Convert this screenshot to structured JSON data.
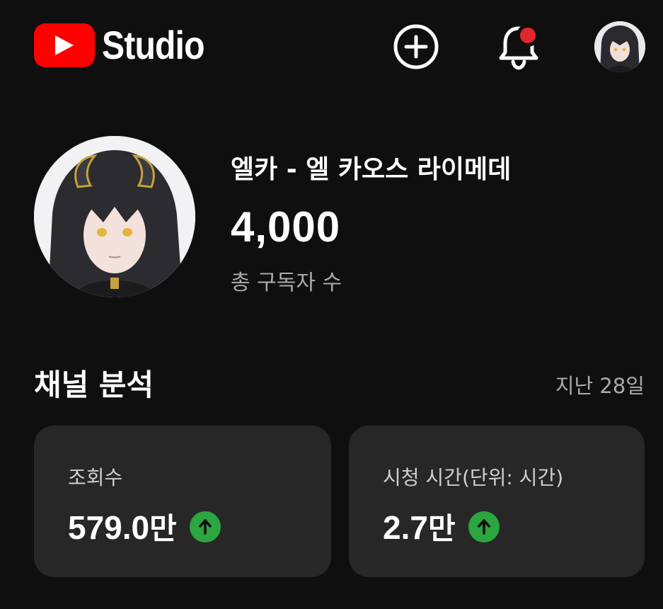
{
  "header": {
    "logo_text": "Studio",
    "icons": [
      "youtube-play-icon",
      "create-plus-icon",
      "notification-bell-icon",
      "account-avatar"
    ]
  },
  "channel": {
    "name": "엘카 - 엘 카오스 라이메데",
    "subscriber_count": "4,000",
    "subscriber_label": "총 구독자 수"
  },
  "analytics": {
    "title": "채널 분석",
    "period": "지난 28일",
    "cards": [
      {
        "label": "조회수",
        "value": "579.0",
        "unit": "만",
        "trend": "up"
      },
      {
        "label": "시청 시간(단위: 시간)",
        "value": "2.7",
        "unit": "만",
        "trend": "up"
      }
    ]
  },
  "colors": {
    "background": "#0f0f0f",
    "card": "#272727",
    "brand_red": "#ff0000",
    "trend_green": "#2ba640",
    "notification_red": "#e3262b"
  }
}
